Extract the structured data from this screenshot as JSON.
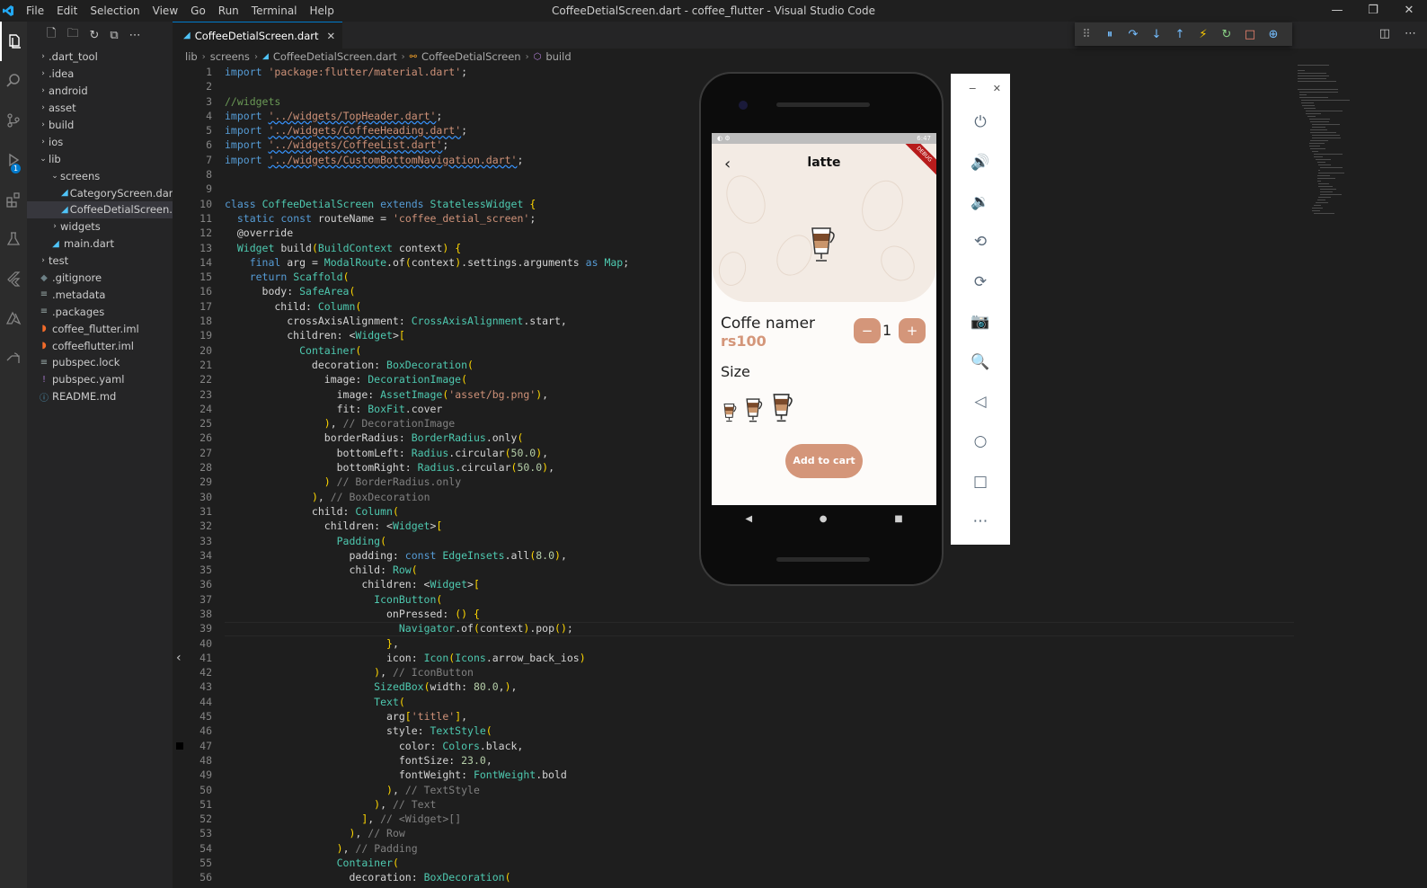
{
  "titlebar": {
    "menu": [
      "File",
      "Edit",
      "Selection",
      "View",
      "Go",
      "Run",
      "Terminal",
      "Help"
    ],
    "title": "CoffeeDetialScreen.dart - coffee_flutter - Visual Studio Code",
    "controls": [
      "—",
      "❐",
      "✕"
    ]
  },
  "activity": {
    "debug_badge": "1"
  },
  "explorer": {
    "items": [
      {
        "label": ".dart_tool",
        "type": "folder",
        "depth": 0,
        "open": false
      },
      {
        "label": ".idea",
        "type": "folder",
        "depth": 0,
        "open": false
      },
      {
        "label": "android",
        "type": "folder",
        "depth": 0,
        "open": false
      },
      {
        "label": "asset",
        "type": "folder",
        "depth": 0,
        "open": false
      },
      {
        "label": "build",
        "type": "folder",
        "depth": 0,
        "open": false
      },
      {
        "label": "ios",
        "type": "folder",
        "depth": 0,
        "open": false
      },
      {
        "label": "lib",
        "type": "folder",
        "depth": 0,
        "open": true
      },
      {
        "label": "screens",
        "type": "folder",
        "depth": 1,
        "open": true
      },
      {
        "label": "CategoryScreen.dart",
        "type": "dart",
        "depth": 2
      },
      {
        "label": "CoffeeDetialScreen.dart",
        "type": "dart",
        "depth": 2,
        "selected": true
      },
      {
        "label": "widgets",
        "type": "folder",
        "depth": 1,
        "open": false
      },
      {
        "label": "main.dart",
        "type": "dart",
        "depth": 1
      },
      {
        "label": "test",
        "type": "folder",
        "depth": 0,
        "open": false
      },
      {
        "label": ".gitignore",
        "type": "git",
        "depth": 0
      },
      {
        "label": ".metadata",
        "type": "plain",
        "depth": 0
      },
      {
        "label": ".packages",
        "type": "plain",
        "depth": 0
      },
      {
        "label": "coffee_flutter.iml",
        "type": "rss",
        "depth": 0
      },
      {
        "label": "coffeeflutter.iml",
        "type": "rss",
        "depth": 0
      },
      {
        "label": "pubspec.lock",
        "type": "plain",
        "depth": 0
      },
      {
        "label": "pubspec.yaml",
        "type": "yaml",
        "depth": 0
      },
      {
        "label": "README.md",
        "type": "info",
        "depth": 0
      }
    ]
  },
  "tab": {
    "label": "CoffeeDetialScreen.dart",
    "close": "✕"
  },
  "breadcrumb": [
    "lib",
    "screens",
    "CoffeeDetialScreen.dart",
    "CoffeeDetialScreen",
    "build"
  ],
  "code_lines": [
    "import 'package:flutter/material.dart';",
    "",
    "//widgets",
    "import '../widgets/TopHeader.dart';",
    "import '../widgets/CoffeeHeading.dart';",
    "import '../widgets/CoffeeList.dart';",
    "import '../widgets/CustomBottomNavigation.dart';",
    "",
    "",
    "class CoffeeDetialScreen extends StatelessWidget {",
    "  static const routeName = 'coffee_detial_screen';",
    "  @override",
    "  Widget build(BuildContext context) {",
    "    final arg = ModalRoute.of(context).settings.arguments as Map;",
    "    return Scaffold(",
    "      body: SafeArea(",
    "        child: Column(",
    "          crossAxisAlignment: CrossAxisAlignment.start,",
    "          children: <Widget>[",
    "            Container(",
    "              decoration: BoxDecoration(",
    "                image: DecorationImage(",
    "                  image: AssetImage('asset/bg.png'),",
    "                  fit: BoxFit.cover",
    "                ), // DecorationImage",
    "                borderRadius: BorderRadius.only(",
    "                  bottomLeft: Radius.circular(50.0),",
    "                  bottomRight: Radius.circular(50.0),",
    "                ) // BorderRadius.only",
    "              ), // BoxDecoration",
    "              child: Column(",
    "                children: <Widget>[",
    "                  Padding(",
    "                    padding: const EdgeInsets.all(8.0),",
    "                    child: Row(",
    "                      children: <Widget>[",
    "                        IconButton(",
    "                          onPressed: () {",
    "                            Navigator.of(context).pop();",
    "                          },",
    "                          icon: Icon(Icons.arrow_back_ios)",
    "                        ), // IconButton",
    "                        SizedBox(width: 80.0,),",
    "                        Text(",
    "                          arg['title'],",
    "                          style: TextStyle(",
    "                            color: Colors.black,",
    "                            fontSize: 23.0,",
    "                            fontWeight: FontWeight.bold",
    "                          ), // TextStyle",
    "                        ), // Text",
    "                      ], // <Widget>[]",
    "                    ), // Row",
    "                  ), // Padding",
    "                  Container(",
    "                    decoration: BoxDecoration("
  ],
  "phone": {
    "status_time": "6:47",
    "debug_ribbon": "DEBUG",
    "title": "latte",
    "product_name": "Coffe namer",
    "price": "rs100",
    "qty": "1",
    "minus": "−",
    "plus": "+",
    "size_label": "Size",
    "add_to_cart": "Add to cart"
  },
  "emulator_panel": {
    "top": [
      "−",
      "✕"
    ],
    "buttons": [
      "power-icon",
      "volume-up-icon",
      "volume-down-icon",
      "rotate-left-icon",
      "rotate-right-icon",
      "camera-icon",
      "zoom-icon",
      "back-icon",
      "home-icon",
      "overview-icon",
      "more-icon"
    ]
  },
  "colors": {
    "accent": "#007acc",
    "coffee": "#d4967a"
  }
}
